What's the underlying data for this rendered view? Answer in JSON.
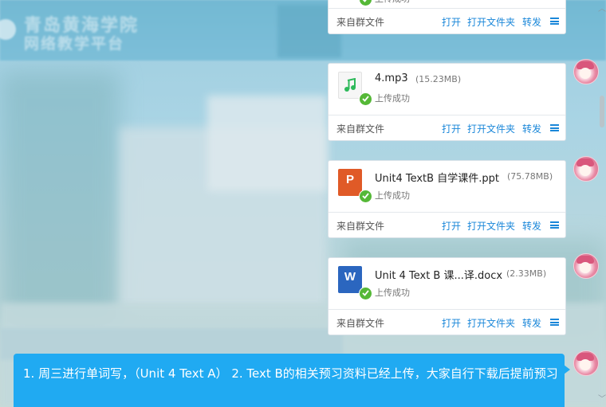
{
  "background": {
    "school_name_line1": "青岛黄海学院",
    "school_name_line2": "网络教学平台"
  },
  "card_labels": {
    "source": "来自群文件",
    "open": "打开",
    "open_folder": "打开文件夹",
    "forward": "转发",
    "uploaded": "上传成功"
  },
  "files": [
    {
      "name": "4.mp3",
      "size": "(15.23MB)",
      "type": "mp3"
    },
    {
      "name": "Unit4 TextB 自学课件.ppt",
      "size": "(75.78MB)",
      "type": "ppt",
      "icon_letter": "P"
    },
    {
      "name": "Unit 4 Text B 课...译.docx",
      "size": "(2.33MB)",
      "type": "docx",
      "icon_letter": "W"
    }
  ],
  "message": {
    "text": "1. 周三进行单词写，（Unit 4 Text A）   2. Text B的相关预习资料已经上传，大家自行下载后提前预习"
  },
  "colors": {
    "accent": "#1a87d9",
    "bubble": "#20aaf2",
    "success": "#55b837",
    "ppt": "#e05a27",
    "word": "#2b66bf"
  }
}
